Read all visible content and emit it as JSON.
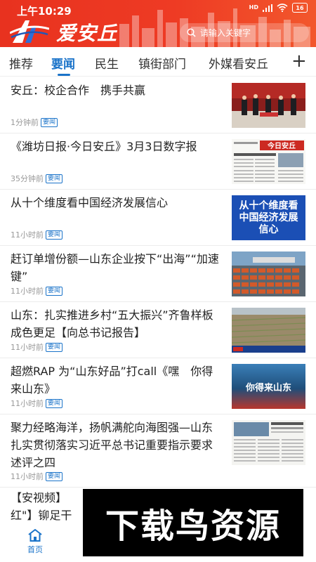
{
  "status": {
    "time": "上午10:29",
    "network": "HD",
    "battery": "16"
  },
  "header": {
    "brand": "爱安丘",
    "search_placeholder": "请输入关键字"
  },
  "tabs": [
    {
      "label": "推荐"
    },
    {
      "label": "要闻"
    },
    {
      "label": "民生"
    },
    {
      "label": "镇街部门"
    },
    {
      "label": "外媒看安丘"
    }
  ],
  "active_tab": "要闻",
  "add_tab_label": "+",
  "news": [
    {
      "title": "安丘：校企合作　携手共赢",
      "time": "1分钟前",
      "tag": "要闻",
      "thumb_text": ""
    },
    {
      "title": "《潍坊日报·今日安丘》3月3日数字报",
      "time": "35分钟前",
      "tag": "要闻",
      "thumb_text": "今日安丘"
    },
    {
      "title": "从十个维度看中国经济发展信心",
      "time": "11小时前",
      "tag": "要闻",
      "thumb_text": "从十个维度看中国经济发展信心"
    },
    {
      "title": "赶订单增份额—山东企业按下“出海”“加速键”",
      "time": "11小时前",
      "tag": "要闻",
      "thumb_text": ""
    },
    {
      "title": "山东：扎实推进乡村“五大振兴”齐鲁样板成色更足【向总书记报告】",
      "time": "11小时前",
      "tag": "要闻",
      "thumb_text": ""
    },
    {
      "title": "超燃RAP 为“山东好品”打call《嘿　你得来山东》",
      "time": "11小时前",
      "tag": "要闻",
      "thumb_text": "你得来山东"
    },
    {
      "title": "聚力经略海洋，扬帆满舵向海图强—山东扎实贯彻落实习近平总书记重要指示要求述评之四",
      "time": "11小时前",
      "tag": "要闻",
      "thumb_text": ""
    },
    {
      "title": "【安视频】",
      "title_line2": "红\"】铆足干",
      "time": "",
      "tag": "",
      "thumb_text": ""
    }
  ],
  "watermark": "下载鸟资源",
  "tabbar": {
    "home_label": "首页"
  },
  "colors": {
    "header_red": "#ee3b24",
    "accent_blue": "#1a73c9",
    "tag_blue": "#1a73c9"
  }
}
